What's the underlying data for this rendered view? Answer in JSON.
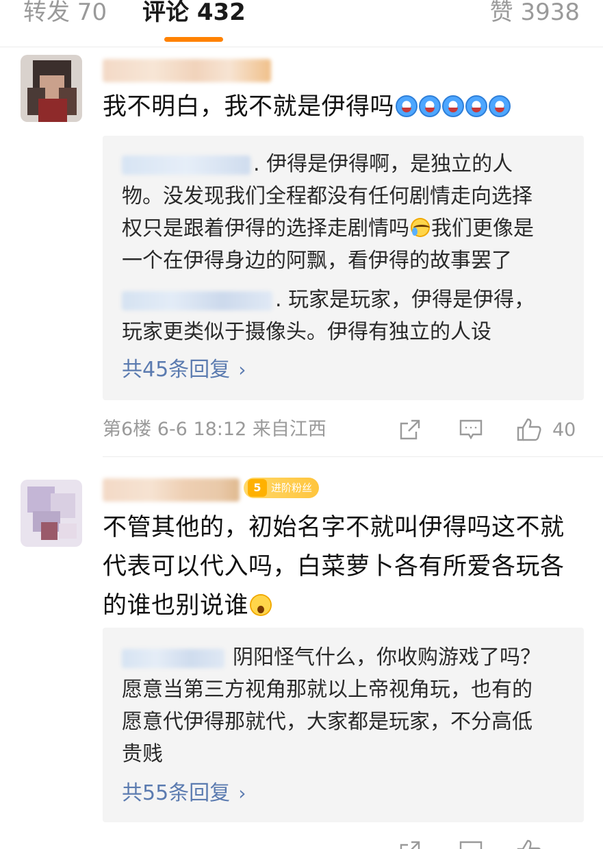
{
  "tabs": {
    "reposts": "转发 70",
    "comments": "评论 432",
    "likes": "赞 3938"
  },
  "comments": [
    {
      "text": "我不明白，我不就是伊得吗",
      "emojis": [
        "laugh-emoji",
        "laugh-emoji",
        "laugh-emoji",
        "laugh-emoji",
        "laugh-emoji"
      ],
      "replies": {
        "lines": [
          ". 伊得是伊得啊，是独立的人",
          "物。没发现我们全程都没有任何剧情走向选择",
          "权只是跟着伊得的选择走剧情吗",
          "我们更像是",
          "一个在伊得身边的阿飘，看伊得的故事罢了",
          ". 玩家是玩家，伊得是伊得，",
          "玩家更类似于摄像头。伊得有独立的人设"
        ],
        "more": "共45条回复"
      },
      "meta": "第6楼  6-6 18:12  来自江西",
      "like_count": "40"
    },
    {
      "badge_level": "5",
      "badge_label": "进阶粉丝",
      "text_lines": [
        "不管其他的，初始名字不就叫伊得吗这不就",
        "代表可以代入吗，白菜萝卜各有所爱各玩各",
        "的谁也别说谁"
      ],
      "replies": {
        "lines": [
          "阴阳怪气什么，你收购游戏了吗？",
          "愿意当第三方视角那就以上帝视角玩，也有的",
          "愿意代伊得那就代，大家都是玩家，不分高低",
          "贵贱"
        ],
        "more": "共55条回复"
      }
    }
  ],
  "colors": {
    "accent": "#ff8200",
    "link": "#5b7bb0",
    "reply_bg": "#f4f4f4",
    "muted": "#9a9a9a"
  }
}
